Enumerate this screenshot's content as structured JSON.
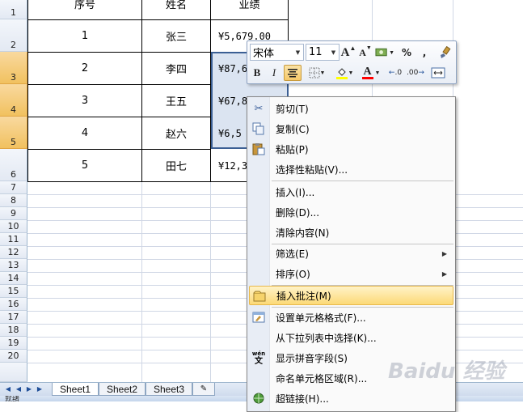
{
  "columns": {
    "no": "序号",
    "name": "姓名",
    "sales": "业绩"
  },
  "row_numbers": [
    "1",
    "2",
    "3",
    "4",
    "5",
    "6",
    "7",
    "8",
    "9",
    "10",
    "11",
    "12",
    "13",
    "14",
    "15",
    "16",
    "17",
    "18",
    "19",
    "20"
  ],
  "rows": [
    {
      "no": "1",
      "name": "张三",
      "sales": "¥5,679.00"
    },
    {
      "no": "2",
      "name": "李四",
      "sales": "¥87,6"
    },
    {
      "no": "3",
      "name": "王五",
      "sales": "¥67,8"
    },
    {
      "no": "4",
      "name": "赵六",
      "sales": "¥6,5"
    },
    {
      "no": "5",
      "name": "田七",
      "sales": "¥12,3"
    }
  ],
  "mini_toolbar": {
    "font_name": "宋体",
    "font_size": "11",
    "grow_font": "A",
    "shrink_font": "A",
    "percent": "%",
    "comma": ",",
    "bold": "B",
    "italic": "I",
    "font_color_letter": "A",
    "inc_decimal": ".0",
    "dec_decimal": ".00"
  },
  "context_menu": {
    "cut": "剪切(T)",
    "copy": "复制(C)",
    "paste": "粘贴(P)",
    "paste_special": "选择性粘贴(V)...",
    "insert": "插入(I)...",
    "delete": "删除(D)...",
    "clear": "清除内容(N)",
    "filter": "筛选(E)",
    "sort": "排序(O)",
    "insert_comment": "插入批注(M)",
    "format_cells": "设置单元格格式(F)...",
    "pick_list": "从下拉列表中选择(K)...",
    "phonetic": "显示拼音字段(S)",
    "name_range": "命名单元格区域(R)...",
    "hyperlink": "超链接(H)..."
  },
  "sheets": [
    "Sheet1",
    "Sheet2",
    "Sheet3"
  ],
  "status": "就绪",
  "watermark": "Baidu 经验",
  "colors": {
    "selected_row_header": "#f1c15f",
    "menu_highlight": "#fcd977",
    "selection_fill": "#bccde6",
    "gridline": "#d0d7e5"
  }
}
